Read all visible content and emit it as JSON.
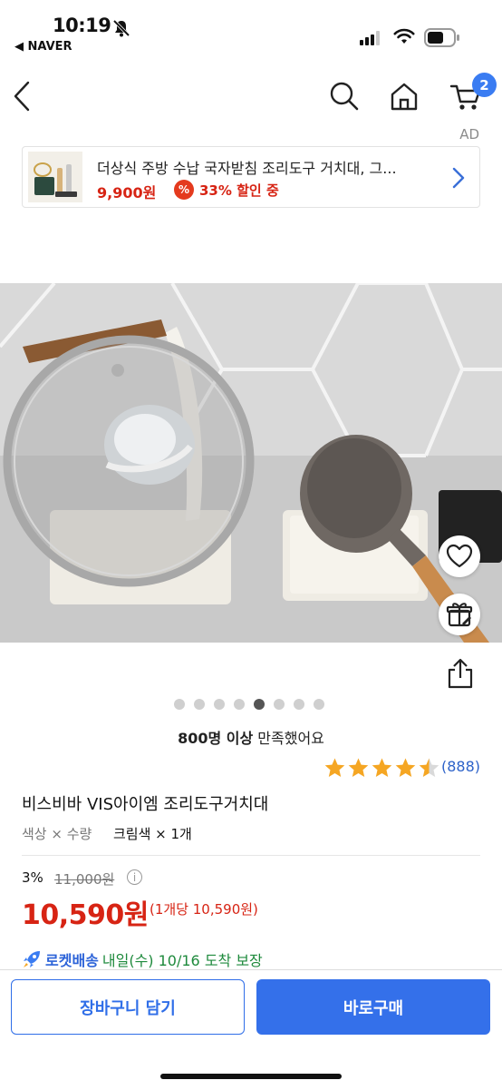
{
  "status_bar": {
    "time": "10:19",
    "source": "◀ NAVER"
  },
  "nav": {
    "cart_count": "2"
  },
  "ad": {
    "label": "AD",
    "title": "더상식 주방 수납 국자받침 조리도구 거치대, 그...",
    "price": "9,900원",
    "discount_badge": "%",
    "discount_text": "33% 할인 중"
  },
  "gallery": {
    "image_count": 8,
    "active_index": 4
  },
  "satisfaction": {
    "bold": "800명 이상",
    "rest": " 만족했어요"
  },
  "rating": {
    "stars": 4.5,
    "review_count": "(888)"
  },
  "product": {
    "title": "비스비바 VIS아이엠 조리도구거치대",
    "option_label": "색상 × 수량",
    "option_value": "크림색 × 1개",
    "discount_rate": "3%",
    "original_price": "11,000원",
    "info_icon": "i",
    "sale_price": "10,590원",
    "unit_price": "(1개당 10,590원)"
  },
  "delivery": {
    "label": "로켓배송",
    "text": "내일(수) 10/16 도착 보장"
  },
  "bottom": {
    "cart_button": "장바구니 담기",
    "buy_button": "바로구매"
  },
  "colors": {
    "accent": "#3470ea",
    "price_red": "#d72414",
    "rating_star": "#f5a623"
  }
}
